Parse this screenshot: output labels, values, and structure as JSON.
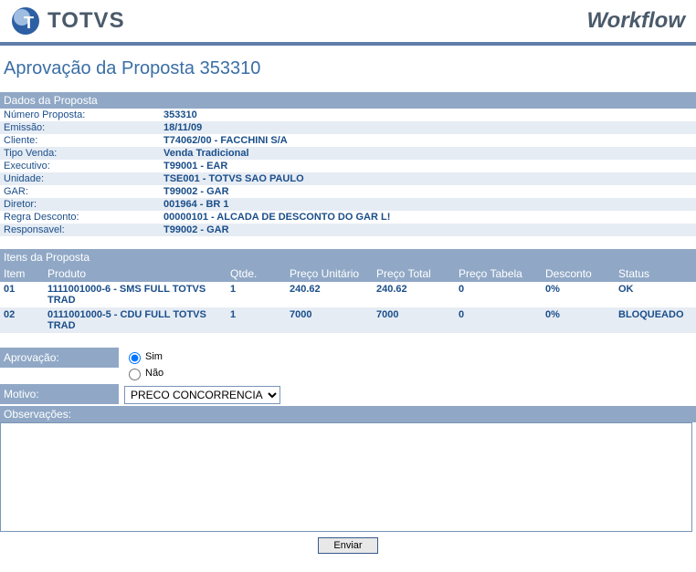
{
  "app": {
    "brand": "TOTVS",
    "module": "Workflow"
  },
  "page_title": "Aprovação da Proposta 353310",
  "proposal_section_title": "Dados da Proposta",
  "proposal_fields": [
    {
      "label": "Número Proposta:",
      "value": "353310"
    },
    {
      "label": "Emissão:",
      "value": "18/11/09"
    },
    {
      "label": "Cliente:",
      "value": "T74062/00 - FACCHINI S/A"
    },
    {
      "label": "Tipo Venda:",
      "value": "Venda Tradicional"
    },
    {
      "label": "Executivo:",
      "value": "T99001 - EAR"
    },
    {
      "label": "Unidade:",
      "value": "TSE001 - TOTVS SAO PAULO"
    },
    {
      "label": "GAR:",
      "value": "T99002 - GAR"
    },
    {
      "label": "Diretor:",
      "value": "001964 - BR 1"
    },
    {
      "label": "Regra Desconto:",
      "value": "00000101 - ALCADA DE DESCONTO DO GAR L!"
    },
    {
      "label": "Responsavel:",
      "value": "T99002 - GAR"
    }
  ],
  "items_section_title": "Itens da Proposta",
  "items_headers": {
    "item": "Item",
    "produto": "Produto",
    "qtde": "Qtde.",
    "preco_unitario": "Preço Unitário",
    "preco_total": "Preço Total",
    "preco_tabela": "Preço Tabela",
    "desconto": "Desconto",
    "status": "Status"
  },
  "items": [
    {
      "item": "01",
      "produto": "1111001000-6 - SMS FULL TOTVS TRAD",
      "qtde": "1",
      "preco_unitario": "240.62",
      "preco_total": "240.62",
      "preco_tabela": "0",
      "desconto": "0%",
      "status": "OK"
    },
    {
      "item": "02",
      "produto": "0111001000-5 - CDU FULL TOTVS TRAD",
      "qtde": "1",
      "preco_unitario": "7000",
      "preco_total": "7000",
      "preco_tabela": "0",
      "desconto": "0%",
      "status": "BLOQUEADO"
    }
  ],
  "approval": {
    "label": "Aprovação:",
    "yes": "Sim",
    "no": "Não",
    "selected": "yes"
  },
  "reason": {
    "label": "Motivo:",
    "selected": "PRECO CONCORRENCIA"
  },
  "observations": {
    "label": "Observações:",
    "value": ""
  },
  "submit_label": "Enviar"
}
